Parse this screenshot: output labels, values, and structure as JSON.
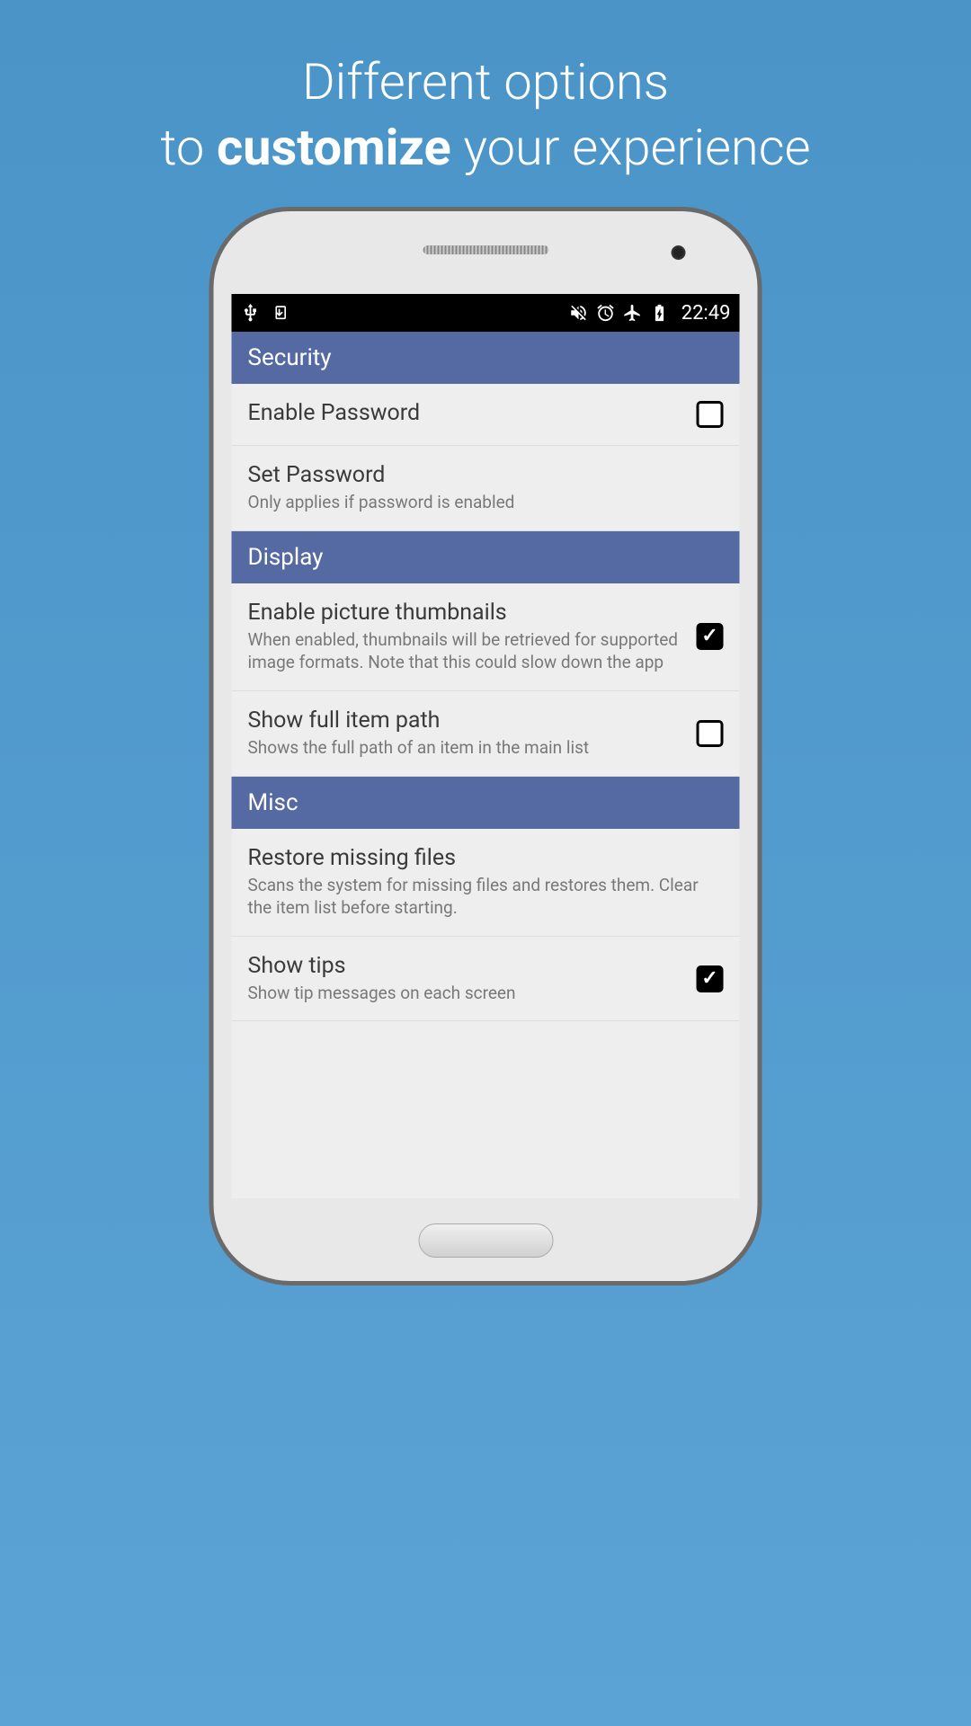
{
  "promo": {
    "line1": "Different options",
    "line2_prefix": "to ",
    "line2_bold": "customize",
    "line2_suffix": " your experience"
  },
  "statusbar": {
    "time": "22:49"
  },
  "sections": {
    "security": {
      "header": "Security",
      "enable_password": {
        "title": "Enable Password",
        "checked": false
      },
      "set_password": {
        "title": "Set Password",
        "subtitle": "Only applies if password is enabled"
      }
    },
    "display": {
      "header": "Display",
      "thumbnails": {
        "title": "Enable picture thumbnails",
        "subtitle": "When enabled, thumbnails will be retrieved for supported image formats. Note that this could slow down the app",
        "checked": true
      },
      "fullpath": {
        "title": "Show full item path",
        "subtitle": "Shows the full path of an item in the main list",
        "checked": false
      }
    },
    "misc": {
      "header": "Misc",
      "restore": {
        "title": "Restore missing files",
        "subtitle": "Scans the system for missing files and restores them. Clear the item list before starting."
      },
      "tips": {
        "title": "Show tips",
        "subtitle": "Show tip messages on each screen",
        "checked": true
      }
    }
  }
}
